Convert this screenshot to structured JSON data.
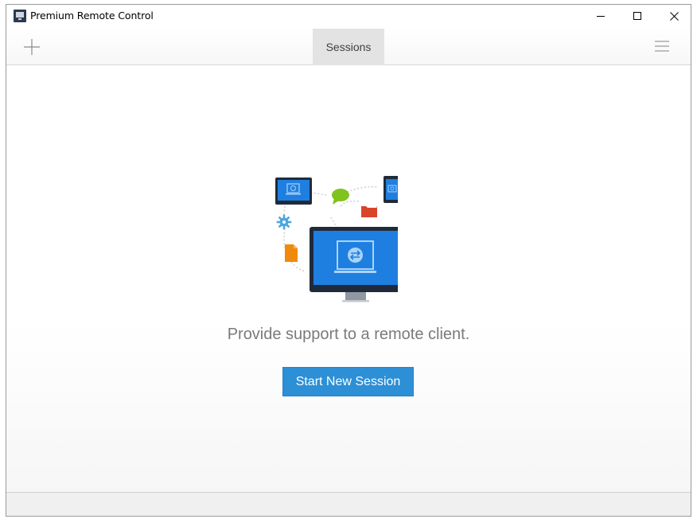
{
  "window": {
    "title": "Premium Remote Control",
    "icon": "app-monitor-icon"
  },
  "toolbar": {
    "add_icon": "plus-icon",
    "tab_label": "Sessions",
    "menu_icon": "hamburger-menu-icon"
  },
  "main": {
    "tagline": "Provide support to a remote client.",
    "start_button_label": "Start New Session"
  },
  "colors": {
    "accent": "#2d8fd6",
    "screen_blue": "#1f7fe0",
    "monitor_frame": "#1f2b3a",
    "chat_green": "#7fc31c",
    "folder_red": "#d9452b",
    "file_orange": "#f08a0c",
    "gear_blue": "#4da6e0"
  }
}
